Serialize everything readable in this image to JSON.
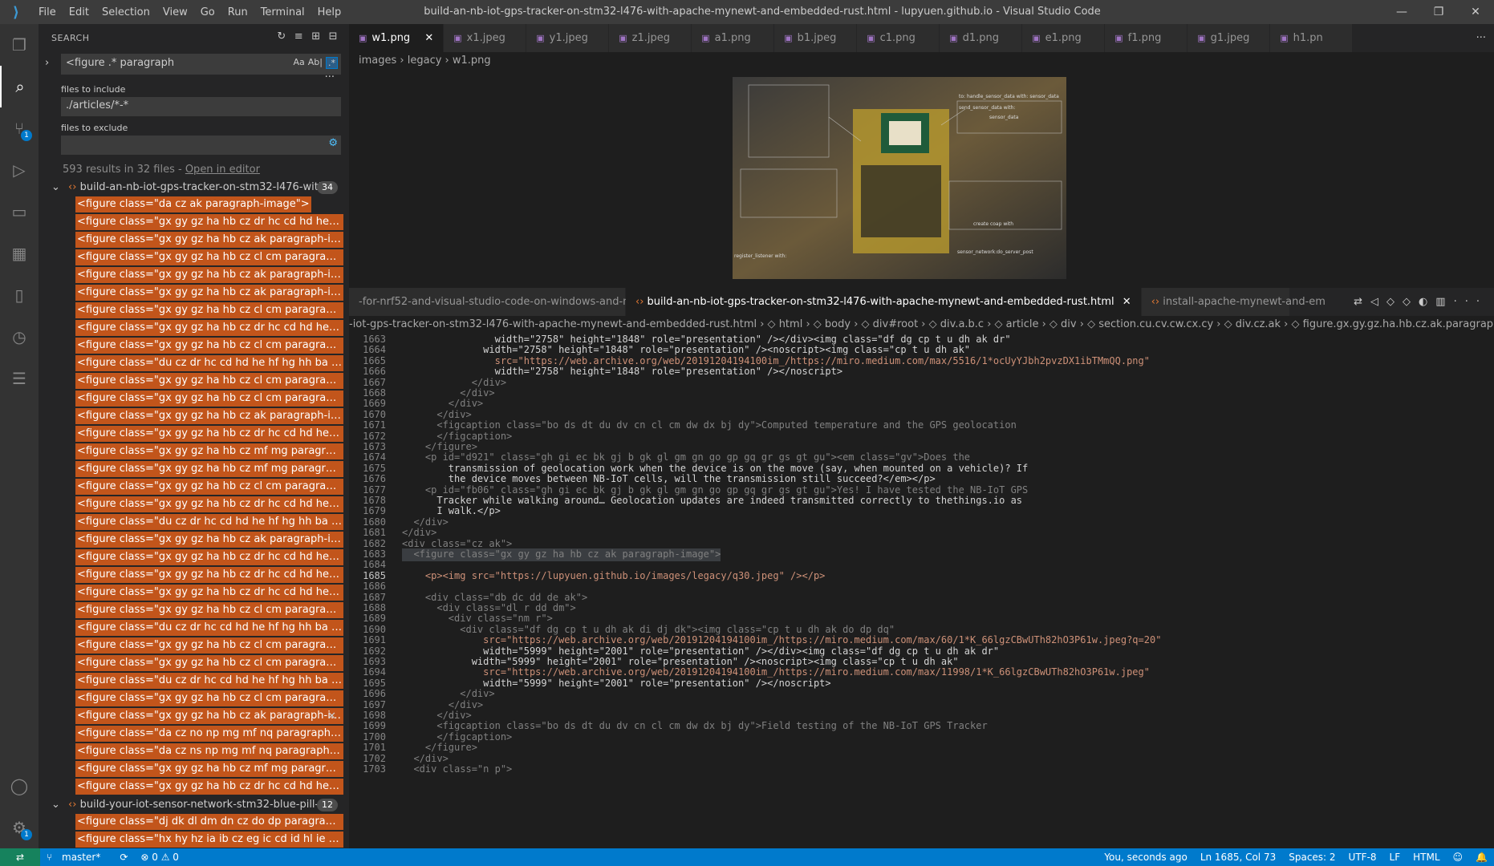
{
  "window": {
    "title": "build-an-nb-iot-gps-tracker-on-stm32-l476-with-apache-mynewt-and-embedded-rust.html - lupyuen.github.io - Visual Studio Code",
    "menu": [
      "File",
      "Edit",
      "Selection",
      "View",
      "Go",
      "Run",
      "Terminal",
      "Help"
    ]
  },
  "activity_bar": {
    "source_control_badge": "1",
    "settings_badge": "1"
  },
  "sidebar": {
    "header": "SEARCH",
    "search_value": "<figure .* paragraph",
    "opt_case": "Aa",
    "opt_word": "Ab|",
    "opt_regex": ".*",
    "files_include_label": "files to include",
    "files_include_value": "./articles/*-*",
    "files_exclude_label": "files to exclude",
    "files_exclude_value": "",
    "summary": "593 results in 32 files - ",
    "open_in_editor": "Open in editor",
    "file1_name": "build-an-nb-iot-gps-tracker-on-stm32-l476-with...",
    "file1_count": "34",
    "results": [
      "<figure class=\"da cz ak paragraph-image\">",
      "<figure class=\"gx gy gz ha hb cz dr hc cd hd he hf hg hh ...",
      "<figure class=\"gx gy gz ha hb cz ak paragraph-image\">",
      "<figure class=\"gx gy gz ha hb cz cl cm paragraph-image\"...",
      "<figure class=\"gx gy gz ha hb cz ak paragraph-image\">",
      "<figure class=\"gx gy gz ha hb cz ak paragraph-image\">",
      "<figure class=\"gx gy gz ha hb cz cl cm paragraph-image\">",
      "<figure class=\"gx gy gz ha hb cz dr hc cd hd he hf hg hh ...",
      "<figure class=\"gx gy gz ha hb cz cl cm paragraph-image\">",
      "<figure class=\"du cz dr hc cd hd he hf hg hh ba hi hj hk ...",
      "<figure class=\"gx gy gz ha hb cz cl cm paragraph-image\">",
      "<figure class=\"gx gy gz ha hb cz cl cm paragraph-image\">",
      "<figure class=\"gx gy gz ha hb cz ak paragraph-image\">",
      "<figure class=\"gx gy gz ha hb cz dr hc cd hd he hf hg hh ...",
      "<figure class=\"gx gy gz ha hb cz mf mg paragraph-image\">",
      "<figure class=\"gx gy gz ha hb cz mf mg paragraph-imag...",
      "<figure class=\"gx gy gz ha hb cz cl cm paragraph-image\">",
      "<figure class=\"gx gy gz ha hb cz dr hc cd hd he hf hg hh ...",
      "<figure class=\"du cz dr hc cd hd he hf hg hh ba hi hj hk ...",
      "<figure class=\"gx gy gz ha hb cz ak paragraph-image\">",
      "<figure class=\"gx gy gz ha hb cz dr hc cd hd he hf hg hh ...",
      "<figure class=\"gx gy gz ha hb cz dr hc cd hd he hf hg hh ...",
      "<figure class=\"gx gy gz ha hb cz dr hc cd hd he hf hg hh ...",
      "<figure class=\"gx gy gz ha hb cz cl cm paragraph-image\">",
      "<figure class=\"du cz dr hc cd hd he hf hg hh ba hi hj hk ...",
      "<figure class=\"gx gy gz ha hb cz cl cm paragraph-image\">",
      "<figure class=\"gx gy gz ha hb cz cl cm paragraph-image\">",
      "<figure class=\"du cz dr hc cd hd he hf hg hh ba hi hj hk ...",
      "<figure class=\"gx gy gz ha hb cz cl cm paragraph-image\">",
      "<figure class=\"gx gy gz ha hb cz ak paragraph-ima...",
      "<figure class=\"da cz no np mg mf nq paragraph-image\">",
      "<figure class=\"da cz ns np mg mf nq paragraph-image\">",
      "<figure class=\"gx gy gz ha hb cz mf mg paragraph-imag...",
      "<figure class=\"gx gy gz ha hb cz dr hc cd hd he hf hg hh ..."
    ],
    "file2_name": "build-your-iot-sensor-network-stm32-blue-pill-...",
    "file2_count": "12",
    "file2_results": [
      "<figure class=\"dj dk dl dm dn cz do dp paragraph-image...",
      "<figure class=\"hx hy hz ia ib cz eg ic cd id hl ie if iq ba ih ..."
    ]
  },
  "editor_top": {
    "tabs": [
      "w1.png",
      "x1.jpeg",
      "y1.jpeg",
      "z1.jpeg",
      "a1.png",
      "b1.jpeg",
      "c1.png",
      "d1.png",
      "e1.png",
      "f1.png",
      "g1.jpeg",
      "h1.pn"
    ],
    "breadcrumb": [
      "images",
      "legacy",
      "w1.png"
    ],
    "image_labels": [
      "to: handle_sensor_data  with: sensor_data",
      "send_sensor_data  with:",
      "sensor_data",
      "create coap with",
      "sensor_network:do_server_post",
      "register_listener with:"
    ]
  },
  "editor_bottom": {
    "tabs": [
      "-for-nrf52-and-visual-studio-code-on-windows-and-macos.html",
      "build-an-nb-iot-gps-tracker-on-stm32-l476-with-apache-mynewt-and-embedded-rust.html",
      "install-apache-mynewt-and-em"
    ],
    "breadcrumb": [
      "-iot-gps-tracker-on-stm32-l476-with-apache-mynewt-and-embedded-rust.html",
      "html",
      "body",
      "div#root",
      "div.a.b.c",
      "article",
      "div",
      "section.cu.cv.cw.cx.cy",
      "div.cz.ak",
      "figure.gx.gy.gz.ha.hb.cz.ak.paragraph-image"
    ],
    "line_numbers": [
      "1663",
      "1664",
      "1665",
      "1666",
      "1667",
      "1668",
      "1669",
      "1670",
      "1671",
      "1672",
      "1673",
      "1674",
      "1675",
      "1676",
      "1677",
      "1678",
      "1679",
      "1680",
      "1681",
      "1682",
      "1683",
      "1684",
      "1685",
      "1686",
      "1687",
      "1688",
      "1689",
      "1690",
      "1691",
      "1692",
      "1693",
      "1694",
      "1695",
      "1696",
      "1697",
      "1698",
      "1699",
      "1700",
      "1701",
      "1702",
      "1703"
    ],
    "current_line": "1685",
    "code_lines": [
      "                width=\"2758\" height=\"1848\" role=\"presentation\" /></div><img class=\"df dg cp t u dh ak dr\"",
      "              width=\"2758\" height=\"1848\" role=\"presentation\" /><noscript><img class=\"cp t u dh ak\"",
      "                src=\"https://web.archive.org/web/20191204194100im_/https://miro.medium.com/max/5516/1*ocUyYJbh2pvzDX1ibTMmQQ.png\"",
      "                width=\"2758\" height=\"1848\" role=\"presentation\" /></noscript>",
      "            </div>",
      "          </div>",
      "        </div>",
      "      </div>",
      "      <figcaption class=\"bo ds dt du dv cn cl cm dw dx bj dy\">Computed temperature and the GPS geolocation",
      "      </figcaption>",
      "    </figure>",
      "    <p id=\"d921\" class=\"gh gi ec bk gj b gk gl gm gn go gp gq gr gs gt gu\"><em class=\"gv\">Does the",
      "        transmission of geolocation work when the device is on the move (say, when mounted on a vehicle)? If",
      "        the device moves between NB-IoT cells, will the transmission still succeed?</em></p>",
      "    <p id=\"fb06\" class=\"gh gi ec bk gj b gk gl gm gn go gp gq gr gs gt gu\">Yes! I have tested the NB-IoT GPS",
      "      Tracker while walking around… Geolocation updates are indeed transmitted correctly to thethings.io as",
      "      I walk.</p>",
      "  </div>",
      "</div>",
      "<div class=\"cz ak\">",
      "  <figure class=\"gx gy gz ha hb cz ak paragraph-image\">",
      "",
      "    <p><img src=\"https://lupyuen.github.io/images/legacy/q30.jpeg\" /></p>",
      "",
      "    <div class=\"db dc dd de ak\">",
      "      <div class=\"dl r dd dm\">",
      "        <div class=\"nm r\">",
      "          <div class=\"df dg cp t u dh ak di dj dk\"><img class=\"cp t u dh ak do dp dq\"",
      "              src=\"https://web.archive.org/web/20191204194100im_/https://miro.medium.com/max/60/1*K_66lgzCBwUTh82hO3P61w.jpeg?q=20\"",
      "              width=\"5999\" height=\"2001\" role=\"presentation\" /></div><img class=\"df dg cp t u dh ak dr\"",
      "            width=\"5999\" height=\"2001\" role=\"presentation\" /><noscript><img class=\"cp t u dh ak\"",
      "              src=\"https://web.archive.org/web/20191204194100im_/https://miro.medium.com/max/11998/1*K_66lgzCBwUTh82hO3P61w.jpeg\"",
      "              width=\"5999\" height=\"2001\" role=\"presentation\" /></noscript>",
      "          </div>",
      "        </div>",
      "      </div>",
      "      <figcaption class=\"bo ds dt du dv cn cl cm dw dx bj dy\">Field testing of the NB-IoT GPS Tracker",
      "      </figcaption>",
      "    </figure>",
      "  </div>",
      "  <div class=\"n p\">"
    ]
  },
  "statusbar": {
    "branch": "master*",
    "sync": "⟳",
    "problems": "⊗ 0 ⚠ 0",
    "blame": "You, seconds ago",
    "position": "Ln 1685, Col 73",
    "spaces": "Spaces: 2",
    "encoding": "UTF-8",
    "eol": "LF",
    "language": "HTML"
  },
  "colors": {
    "accent": "#007acc",
    "match_bg": "#c2551b",
    "statusbar": "#007acc"
  }
}
